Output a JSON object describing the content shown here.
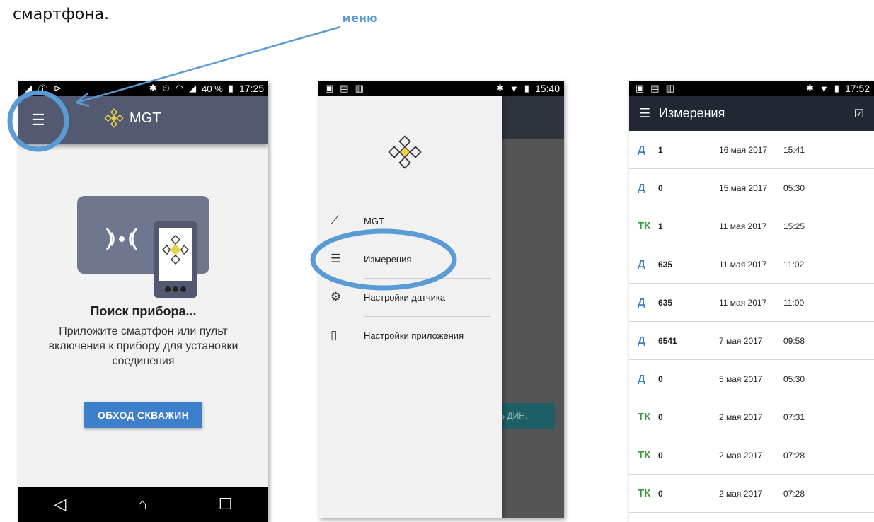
{
  "doc": {
    "text": "смартфона.",
    "callout": "меню"
  },
  "colors": {
    "accent": "#5b9bd5",
    "appbar1": "#535970",
    "appbar3": "#212733",
    "button": "#3d7fcb",
    "type_d": "#3b7fc4",
    "type_tk": "#3b9a3b"
  },
  "phone1": {
    "status": {
      "battery": "40 %",
      "time": "17:25"
    },
    "menu_icon": "hamburger-icon",
    "brand": "MGT",
    "search_title": "Поиск прибора...",
    "search_desc": "Приложите смартфон или пульт включения к прибору для установки соединения",
    "button": "ОБХОД СКВАЖИН",
    "nav": [
      "back-icon",
      "home-icon",
      "recents-icon"
    ]
  },
  "phone2": {
    "status": {
      "time": "15:40"
    },
    "menu": [
      {
        "icon": "chart-icon",
        "label": "MGT"
      },
      {
        "icon": "list-icon",
        "label": "Измерения"
      },
      {
        "icon": "gear-icon",
        "label": "Настройки датчика"
      },
      {
        "icon": "phone-icon",
        "label": "Настройки приложения"
      }
    ],
    "bg_button_partial": "ТЬ ДИН."
  },
  "phone3": {
    "status": {
      "time": "17:52"
    },
    "title": "Измерения",
    "rows": [
      {
        "type": "Д",
        "num": "1",
        "date": "16 мая 2017",
        "time": "15:41"
      },
      {
        "type": "Д",
        "num": "0",
        "date": "15 мая 2017",
        "time": "05:30"
      },
      {
        "type": "ТК",
        "num": "1",
        "date": "11 мая 2017",
        "time": "15:25"
      },
      {
        "type": "Д",
        "num": "635",
        "date": "11 мая 2017",
        "time": "11:02"
      },
      {
        "type": "Д",
        "num": "635",
        "date": "11 мая 2017",
        "time": "11:00"
      },
      {
        "type": "Д",
        "num": "6541",
        "date": "7 мая 2017",
        "time": "09:58"
      },
      {
        "type": "Д",
        "num": "0",
        "date": "5 мая 2017",
        "time": "05:30"
      },
      {
        "type": "ТК",
        "num": "0",
        "date": "2 мая 2017",
        "time": "07:31"
      },
      {
        "type": "ТК",
        "num": "0",
        "date": "2 мая 2017",
        "time": "07:28"
      },
      {
        "type": "ТК",
        "num": "0",
        "date": "2 мая 2017",
        "time": "07:28"
      }
    ]
  }
}
